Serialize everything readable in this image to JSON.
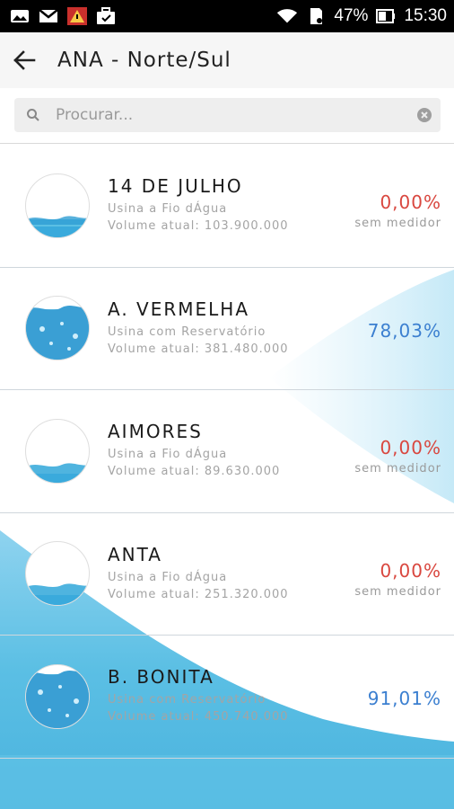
{
  "status_bar": {
    "battery": "47%",
    "time": "15:30",
    "left_icons": [
      "photo-icon",
      "gmail-icon",
      "warning-app-icon",
      "briefcase-icon"
    ],
    "right_icons": [
      "wifi-icon",
      "sd-card-icon",
      "battery-icon"
    ]
  },
  "app_bar": {
    "title": "ANA - Norte/Sul",
    "back_icon": "arrow-left-icon"
  },
  "search": {
    "placeholder": "Procurar...",
    "value": ""
  },
  "items": [
    {
      "name": "14 DE JULHO",
      "type": "Usina a Fio dÁgua",
      "volume": "Volume atual: 103.900.000",
      "percent": "0,00%",
      "status": "sem medidor",
      "level": "low"
    },
    {
      "name": "A. VERMELHA",
      "type": "Usina com Reservatório",
      "volume": "Volume atual: 381.480.000",
      "percent": "78,03%",
      "status": "",
      "level": "high"
    },
    {
      "name": "AIMORES",
      "type": "Usina a Fio dÁgua",
      "volume": "Volume atual: 89.630.000",
      "percent": "0,00%",
      "status": "sem medidor",
      "level": "low"
    },
    {
      "name": "ANTA",
      "type": "Usina a Fio dÁgua",
      "volume": "Volume atual: 251.320.000",
      "percent": "0,00%",
      "status": "sem medidor",
      "level": "low"
    },
    {
      "name": "B. BONITA",
      "type": "Usina com Reservatório",
      "volume": "Volume atual: 450.740.000",
      "percent": "91,01%",
      "status": "",
      "level": "high"
    }
  ],
  "colors": {
    "percent_zero": "#d9473f",
    "percent_value": "#3b7fd0",
    "water": "#5bbfe4"
  }
}
